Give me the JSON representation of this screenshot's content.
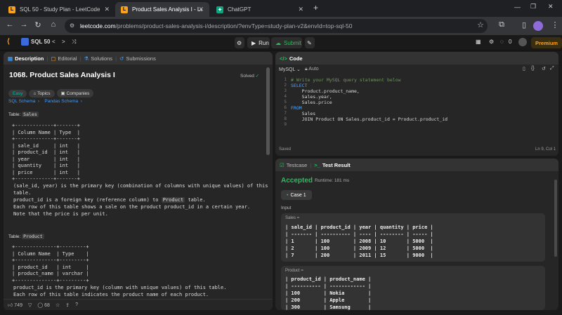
{
  "browser": {
    "tabs": [
      {
        "title": "SQL 50 - Study Plan - LeetCode"
      },
      {
        "title": "Product Sales Analysis I - LeetCo"
      },
      {
        "title": "ChatGPT"
      }
    ],
    "url_domain": "leetcode.com",
    "url_path": "/problems/product-sales-analysis-i/description/?envType=study-plan-v2&envId=top-sql-50"
  },
  "header": {
    "plan": "SQL 50",
    "run": "Run",
    "submit": "Submit",
    "count": "0",
    "premium": "Premium"
  },
  "left": {
    "tabs": [
      "Description",
      "Editorial",
      "Solutions",
      "Submissions"
    ],
    "title": "1068. Product Sales Analysis I",
    "solved": "Solved",
    "tags": [
      "Easy",
      "Topics",
      "Companies"
    ],
    "schema_links": [
      "SQL Schema",
      "Pandas Schema"
    ],
    "table1_label": "Table:",
    "table1_name": "Sales",
    "table1_ascii": "+-------------+-------+\n| Column Name | Type  |\n+-------------+-------+\n| sale_id     | int   |\n| product_id  | int   |\n| year        | int   |\n| quantity    | int   |\n| price       | int   |\n+-------------+-------+",
    "table1_desc_1": "(sale_id, year) is the primary key (combination of columns with unique values) of this",
    "table1_desc_2": "table.",
    "table1_desc_3a": "product_id is a foreign key (reference column) to ",
    "table1_desc_3b": "Product",
    "table1_desc_3c": " table.",
    "table1_desc_4": "Each row of this table shows a sale on the product product_id in a certain year.",
    "table1_desc_5": "Note that the price is per unit.",
    "table2_label": "Table:",
    "table2_name": "Product",
    "table2_ascii": "+--------------+---------+\n| Column Name  | Type    |\n+--------------+---------+\n| product_id   | int     |\n| product_name | varchar |\n+--------------+---------+",
    "table2_desc_1": "product_id is the primary key (column with unique values) of this table.",
    "table2_desc_2": "Each row of this table indicates the product name of each product.",
    "likes": "749",
    "comments": "68"
  },
  "code": {
    "title": "Code",
    "language": "MySQL",
    "auto": "Auto",
    "lines": [
      "# Write your MySQL query statement below",
      "SELECT",
      "    Product.product_name,",
      "    Sales.year,",
      "    Sales.price",
      "FROM",
      "    Sales",
      "    JOIN Product ON Sales.product_id = Product.product_id",
      ""
    ],
    "line_numbers": [
      "1",
      "2",
      "3",
      "4",
      "5",
      "6",
      "7",
      "8",
      "9"
    ],
    "status": "Saved",
    "cursor": "Ln 9, Col 1"
  },
  "result": {
    "tabs": [
      "Testcase",
      "Test Result"
    ],
    "verdict": "Accepted",
    "runtime": "Runtime: 181 ms",
    "case": "Case 1",
    "input_label": "Input",
    "sales_label": "Sales =",
    "sales_table": "| sale_id | product_id | year | quantity | price |\n| ------- | ---------- | ---- | -------- | ----- |\n| 1       | 100        | 2008 | 10       | 5000  |\n| 2       | 100        | 2009 | 12       | 5000  |\n| 7       | 200        | 2011 | 15       | 9000  |",
    "product_label": "Product =",
    "product_table": "| product_id | product_name |\n| ---------- | ------------ |\n| 100        | Nokia        |\n| 200        | Apple        |\n| 300        | Samsung      |"
  },
  "colors": {
    "accent_green": "#2cbb5d",
    "easy": "#00b8a3",
    "premium": "#ffa116",
    "link": "#3b9bff"
  }
}
